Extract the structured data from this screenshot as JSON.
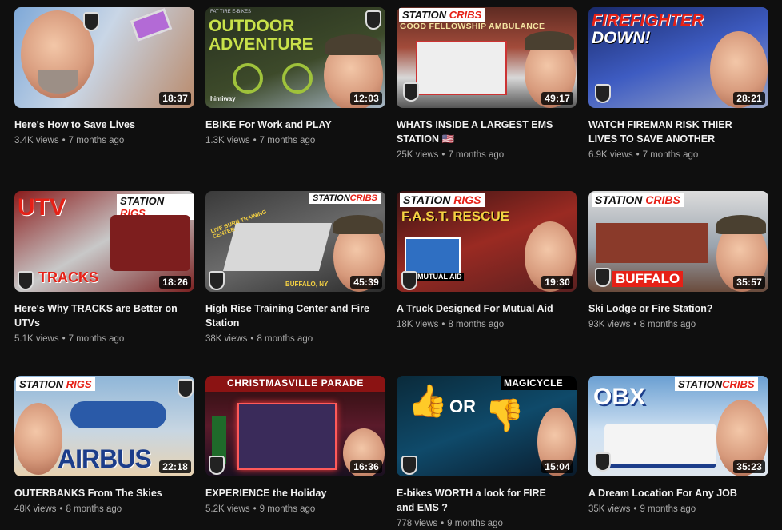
{
  "videos": [
    {
      "title": "Here's How to Save Lives",
      "views": "3.4K views",
      "age": "7 months ago",
      "duration": "18:37"
    },
    {
      "title": "EBIKE For Work and PLAY",
      "views": "1.3K views",
      "age": "7 months ago",
      "duration": "12:03",
      "thumb_text": {
        "top": "FAT TIRE E-BIKES",
        "main1": "OUTDOOR",
        "main2": "ADVENTURE",
        "brand": "himiway"
      }
    },
    {
      "title": "WHATS INSIDE A LARGEST EMS STATION 🇺🇸",
      "views": "25K views",
      "age": "7 months ago",
      "duration": "49:17",
      "thumb_text": {
        "label1": "STATION",
        "label2": "CRIBS",
        "sub": "GOOD FELLOWSHIP AMBULANCE"
      }
    },
    {
      "title": "WATCH FIREMAN RISK THIER LIVES TO SAVE ANOTHER",
      "views": "6.9K views",
      "age": "7 months ago",
      "duration": "28:21",
      "thumb_text": {
        "main1": "FIREFIGHTER",
        "main2": "DOWN!"
      }
    },
    {
      "title": "Here's Why TRACKS are Better on UTVs",
      "views": "5.1K views",
      "age": "7 months ago",
      "duration": "18:26",
      "thumb_text": {
        "main": "UTV",
        "bottom": "TRACKS",
        "label1": "STATION",
        "label2": "RIGS"
      }
    },
    {
      "title": "High Rise Training Center and Fire Station",
      "views": "38K views",
      "age": "8 months ago",
      "duration": "45:39",
      "thumb_text": {
        "label1": "STATION",
        "label2": "CRIBS",
        "note": "LIVE BURN TRAINING CENTER",
        "loc": "BUFFALO, NY"
      }
    },
    {
      "title": "A Truck Designed For Mutual Aid",
      "views": "18K views",
      "age": "8 months ago",
      "duration": "19:30",
      "thumb_text": {
        "label1": "STATION",
        "label2": "RIGS",
        "sub": "F.A.S.T. RESCUE",
        "note": "MUTUAL AID"
      }
    },
    {
      "title": "Ski Lodge or Fire Station?",
      "views": "93K views",
      "age": "8 months ago",
      "duration": "35:57",
      "thumb_text": {
        "label1": "STATION",
        "label2": "CRIBS",
        "bottom": "BUFFALO"
      }
    },
    {
      "title": "OUTERBANKS From The Skies",
      "views": "48K views",
      "age": "8 months ago",
      "duration": "22:18",
      "thumb_text": {
        "label1": "STATION",
        "label2": "RIGS",
        "main": "AIRBUS"
      }
    },
    {
      "title": "EXPERIENCE the Holiday",
      "views": "5.2K views",
      "age": "9 months ago",
      "duration": "16:36",
      "thumb_text": {
        "top": "CHRISTMASVILLE PARADE"
      }
    },
    {
      "title": "E-bikes WORTH a look for FIRE and EMS ?",
      "views": "778 views",
      "age": "9 months ago",
      "duration": "15:04",
      "thumb_text": {
        "brand": "MAGICYCLE",
        "mid": "OR"
      }
    },
    {
      "title": "A Dream Location For Any JOB",
      "views": "35K views",
      "age": "9 months ago",
      "duration": "35:23",
      "thumb_text": {
        "main": "OBX",
        "label1": "STATION",
        "label2": "CRIBS"
      }
    }
  ],
  "colors": {
    "bg": "#0f0f0f",
    "title": "#f1f1f1",
    "meta": "#aaaaaa",
    "accent_red": "#e62117",
    "accent_yellow": "#f5d142"
  }
}
